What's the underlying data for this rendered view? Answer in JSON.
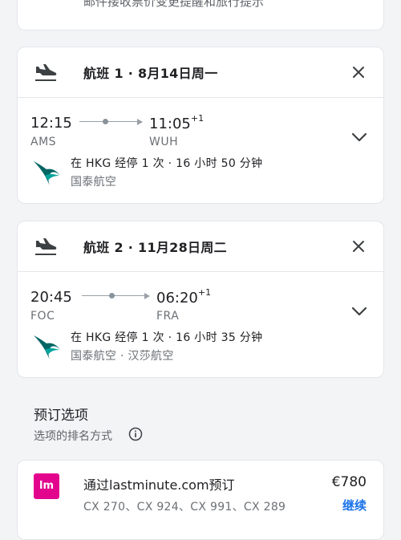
{
  "alert": {
    "text": "邮件接收票价变更提醒和旅行提示"
  },
  "flights": [
    {
      "header": "航班 1 · 8月14日周一",
      "depart_time": "12:15",
      "depart_code": "AMS",
      "arrive_time": "11:05",
      "arrive_offset": "+1",
      "arrive_code": "WUH",
      "stop_info": "在 HKG 经停 1 次 · 16 小时 50 分钟",
      "airline": "国泰航空"
    },
    {
      "header": "航班 2 · 11月28日周二",
      "depart_time": "20:45",
      "depart_code": "FOC",
      "arrive_time": "06:20",
      "arrive_offset": "+1",
      "arrive_code": "FRA",
      "stop_info": "在 HKG 经停 1 次 · 16 小时 35 分钟",
      "airline": "国泰航空 · 汉莎航空"
    }
  ],
  "booking": {
    "section_title": "预订选项",
    "sort_label": "选项的排名方式",
    "options": [
      {
        "logo_text": "lm",
        "title": "通过lastminute.com预订",
        "flight_numbers": "CX 270、CX 924、CX 991、CX 289",
        "price": "€780",
        "action": "继续"
      }
    ]
  },
  "colors": {
    "accent": "#1a73e8",
    "lastminute_brand": "#e3048e",
    "cathay_green": "#006564"
  }
}
